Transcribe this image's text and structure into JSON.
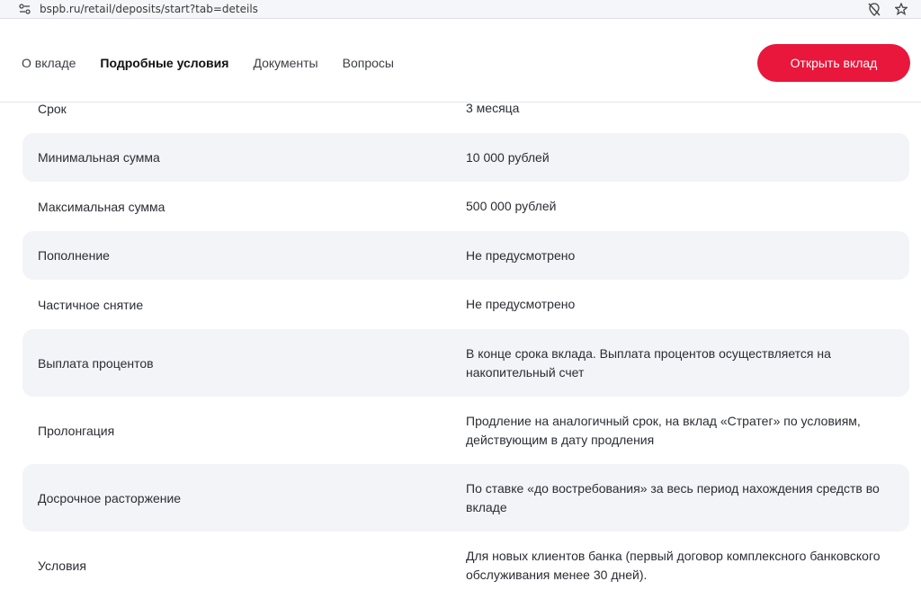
{
  "browser": {
    "url": "bspb.ru/retail/deposits/start?tab=deteils"
  },
  "nav": {
    "tabs": [
      {
        "label": "О вкладе",
        "active": false
      },
      {
        "label": "Подробные условия",
        "active": true
      },
      {
        "label": "Документы",
        "active": false
      },
      {
        "label": "Вопросы",
        "active": false
      }
    ],
    "open_button": "Открыть вклад"
  },
  "conditions": {
    "rows": [
      {
        "label": "Срок",
        "value": "3 месяца"
      },
      {
        "label": "Минимальная сумма",
        "value": "10 000 рублей"
      },
      {
        "label": "Максимальная сумма",
        "value": "500 000 рублей"
      },
      {
        "label": "Пополнение",
        "value": "Не предусмотрено"
      },
      {
        "label": "Частичное снятие",
        "value": "Не предусмотрено"
      },
      {
        "label": "Выплата процентов",
        "value": "В конце срока вклада. Выплата процентов  осуществляется на накопительный счет"
      },
      {
        "label": "Пролонгация",
        "value": "Продление на аналогичный срок, на вклад «Стратег» по условиям, действующим в дату продления"
      },
      {
        "label": "Досрочное расторжение",
        "value": "По ставке «до востребования» за весь период нахождения средств во вкладе"
      },
      {
        "label": "Условия",
        "value": "Для новых клиентов банка (первый договор комплексного банковского обслуживания менее 30 дней)."
      }
    ]
  },
  "colors": {
    "accent": "#e8173b",
    "row_shade": "#f2f4f7"
  }
}
